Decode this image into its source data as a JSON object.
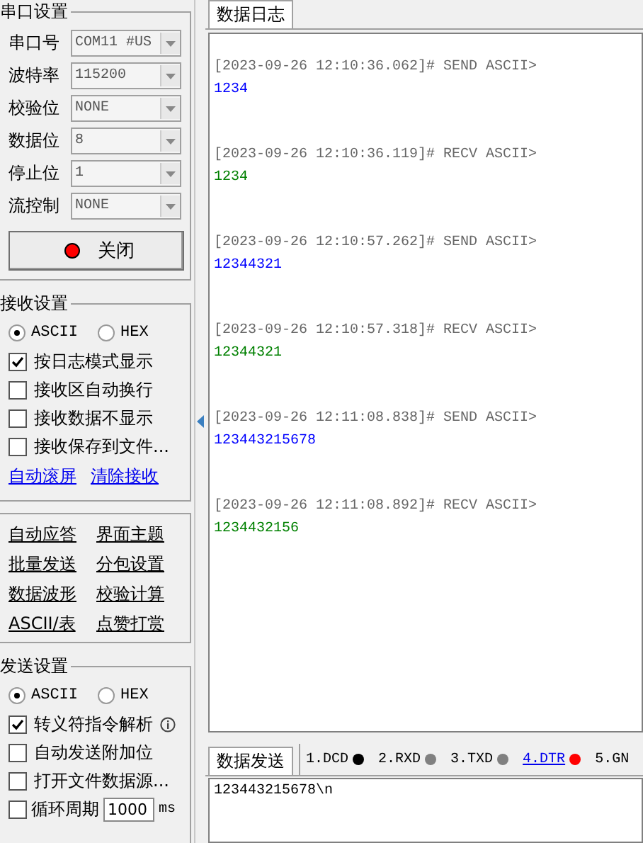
{
  "serial_settings": {
    "title": "串口设置",
    "fields": [
      {
        "label": "串口号",
        "value": "COM11 #US"
      },
      {
        "label": "波特率",
        "value": "115200"
      },
      {
        "label": "校验位",
        "value": "NONE"
      },
      {
        "label": "数据位",
        "value": "8"
      },
      {
        "label": "停止位",
        "value": "1"
      },
      {
        "label": "流控制",
        "value": "NONE"
      }
    ],
    "open_button": {
      "label": "关闭",
      "on": true
    }
  },
  "receive_settings": {
    "title": "接收设置",
    "modes": [
      {
        "label": "ASCII",
        "selected": true
      },
      {
        "label": "HEX",
        "selected": false
      }
    ],
    "options": [
      {
        "label": "按日志模式显示",
        "checked": true
      },
      {
        "label": "接收区自动换行",
        "checked": false
      },
      {
        "label": "接收数据不显示",
        "checked": false
      },
      {
        "label": "接收保存到文件...",
        "checked": false
      }
    ],
    "links": [
      "自动滚屏",
      "清除接收"
    ]
  },
  "tools": [
    "自动应答",
    "界面主题",
    "批量发送",
    "分包设置",
    "数据波形",
    "校验计算",
    "ASCII/表",
    "点赞打赏"
  ],
  "send_settings": {
    "title": "发送设置",
    "modes": [
      {
        "label": "ASCII",
        "selected": true
      },
      {
        "label": "HEX",
        "selected": false
      }
    ],
    "options": [
      {
        "label": "转义符指令解析",
        "checked": true,
        "info": true
      },
      {
        "label": "自动发送附加位",
        "checked": false
      },
      {
        "label": "打开文件数据源...",
        "checked": false
      },
      {
        "label": "循环周期",
        "checked": false,
        "period": "1000",
        "unit": "ms"
      }
    ]
  },
  "log_tab": {
    "label": "数据日志",
    "selected": true
  },
  "log": [
    {
      "kind": "send",
      "header": "[2023-09-26 12:10:36.062]# SEND ASCII>",
      "data": "1234"
    },
    {
      "kind": "recv",
      "header": "[2023-09-26 12:10:36.119]# RECV ASCII>",
      "data": "1234"
    },
    {
      "kind": "send",
      "header": "[2023-09-26 12:10:57.262]# SEND ASCII>",
      "data": "12344321"
    },
    {
      "kind": "recv",
      "header": "[2023-09-26 12:10:57.318]# RECV ASCII>",
      "data": "12344321"
    },
    {
      "kind": "send",
      "header": "[2023-09-26 12:11:08.838]# SEND ASCII>",
      "data": "123443215678"
    },
    {
      "kind": "recv",
      "header": "[2023-09-26 12:11:08.892]# RECV ASCII>",
      "data": "1234432156"
    }
  ],
  "send_tab": {
    "label": "数据发送",
    "selected": true
  },
  "signals": [
    {
      "label": "1.DCD",
      "color": "#000000",
      "highlighted": false
    },
    {
      "label": "2.RXD",
      "color": "#808080",
      "highlighted": false
    },
    {
      "label": "3.TXD",
      "color": "#808080",
      "highlighted": false
    },
    {
      "label": "4.DTR",
      "color": "#ff0000",
      "highlighted": true
    },
    {
      "label": "5.GN",
      "highlighted": false
    }
  ],
  "send_input": {
    "value": "123443215678\\n"
  }
}
